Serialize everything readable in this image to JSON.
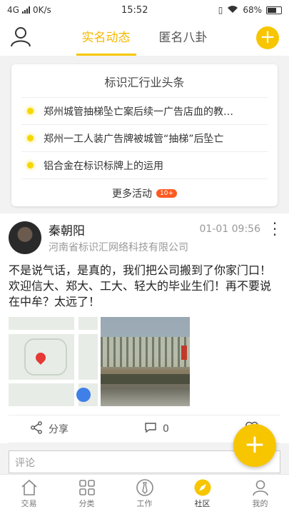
{
  "status_bar": {
    "network": "4G",
    "speed": "0K/s",
    "time": "15:52",
    "battery": "68%"
  },
  "top_nav": {
    "tabs": [
      {
        "label": "实名动态",
        "active": true
      },
      {
        "label": "匿名八卦",
        "active": false
      }
    ],
    "icons": {
      "left": "user-icon",
      "right": "plus-icon"
    }
  },
  "news_card": {
    "title": "标识汇行业头条",
    "items": [
      "郑州城管抽梯坠亡案后续一广告店血的教…",
      "郑州一工人装广告牌被城管“抽梯”后坠亡",
      "铝合金在标识标牌上的运用"
    ],
    "more_label": "更多活动",
    "more_badge": "10+"
  },
  "post": {
    "author_name": "秦朝阳",
    "author_org": "河南省标识汇网络科技有限公司",
    "time": "01-01 09:56",
    "text": "不是说气话，是真的，我们把公司搬到了你家门口！欢迎信大、郑大、工大、轻大的毕业生们！再不要说在中牟？太远了！",
    "share_label": "分享",
    "comment_count": "0",
    "comment_placeholder": "评论"
  },
  "bottom_nav": [
    {
      "label": "交易",
      "icon": "home-icon",
      "active": false
    },
    {
      "label": "分类",
      "icon": "grid-icon",
      "active": false
    },
    {
      "label": "工作",
      "icon": "tie-icon",
      "active": false
    },
    {
      "label": "社区",
      "icon": "compass-icon",
      "active": true
    },
    {
      "label": "我的",
      "icon": "person-icon",
      "active": false
    }
  ],
  "colors": {
    "accent": "#f7c600",
    "badge": "#ff5a1f"
  }
}
